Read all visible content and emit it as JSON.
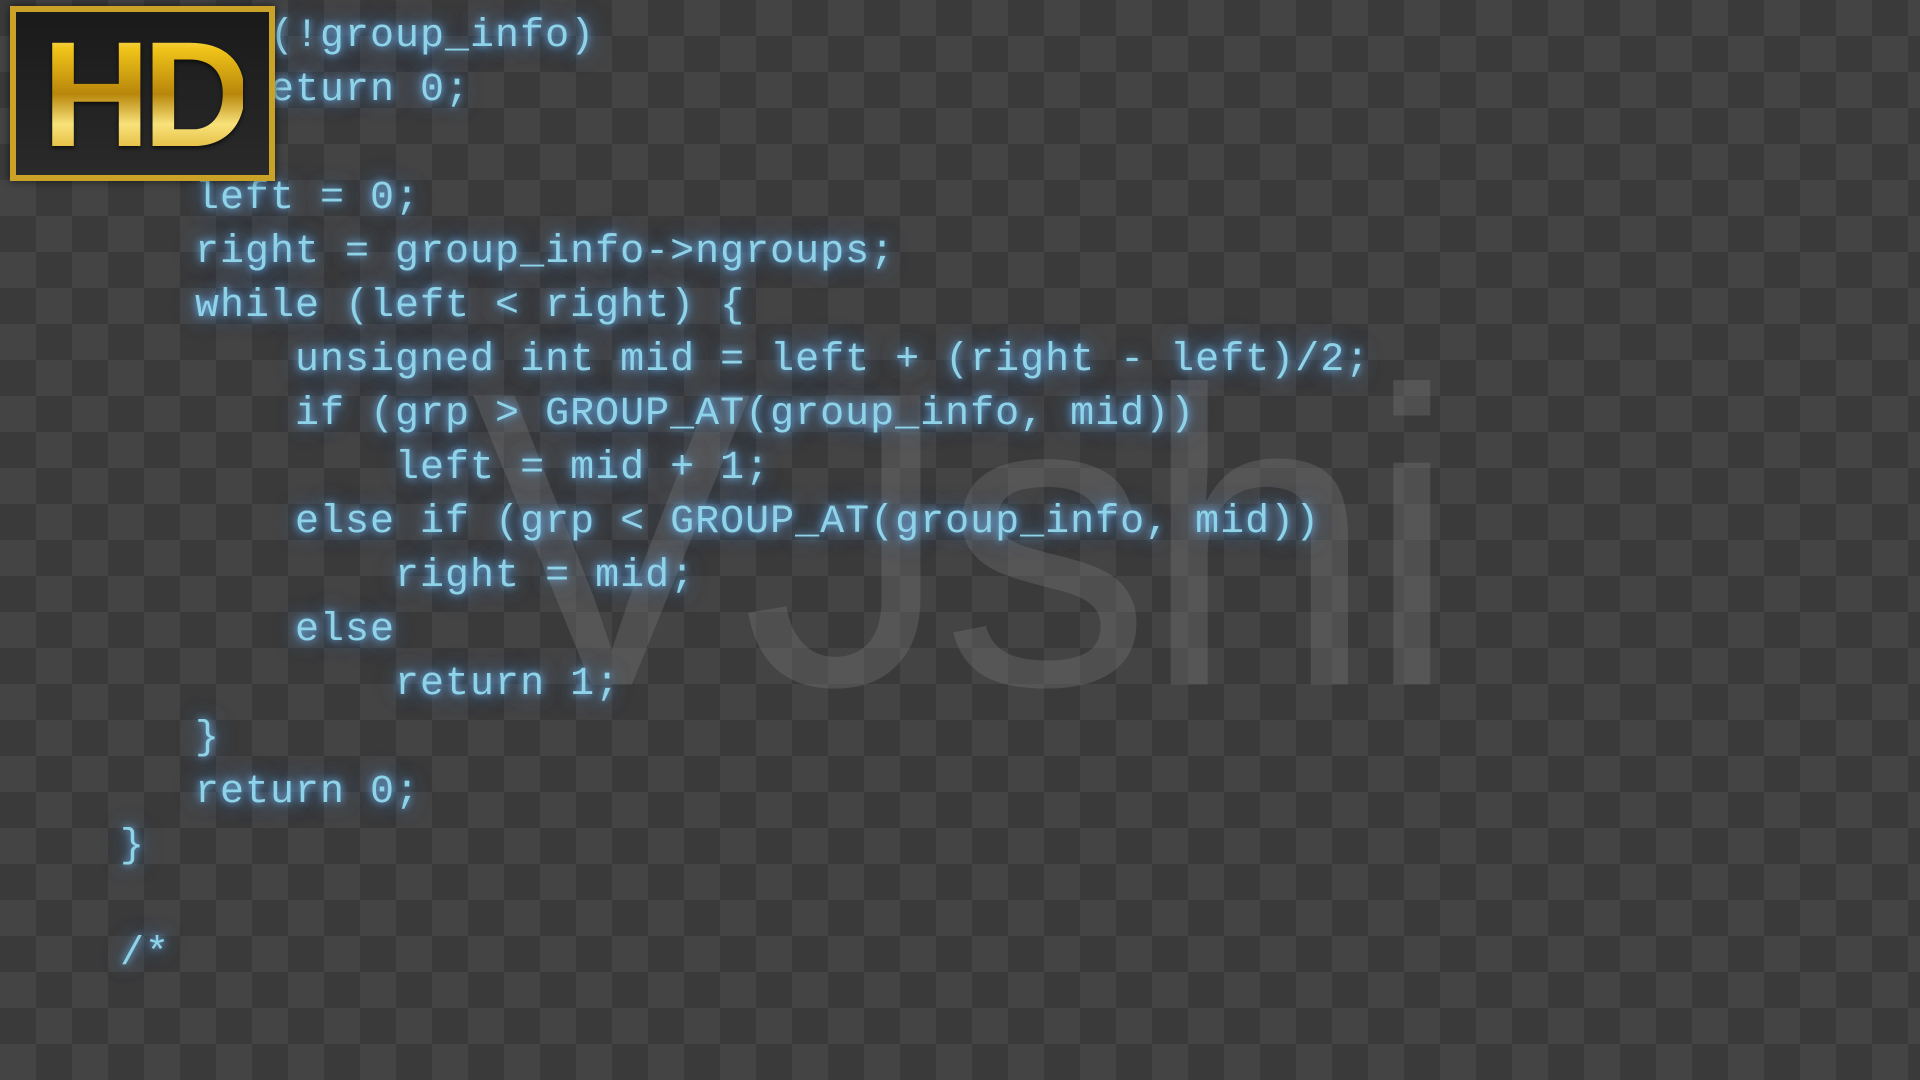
{
  "badge": {
    "label": "HD"
  },
  "watermark": {
    "text": "VJshi"
  },
  "code": {
    "lines": [
      "    f (!group_info)",
      "     return 0;",
      "",
      "   left = 0;",
      "   right = group_info->ngroups;",
      "   while (left < right) {",
      "       unsigned int mid = left + (right - left)/2;",
      "       if (grp > GROUP_AT(group_info, mid))",
      "           left = mid + 1;",
      "       else if (grp < GROUP_AT(group_info, mid))",
      "           right = mid;",
      "       else",
      "           return 1;",
      "   }",
      "   return 0;",
      "}",
      "",
      "/*"
    ]
  }
}
